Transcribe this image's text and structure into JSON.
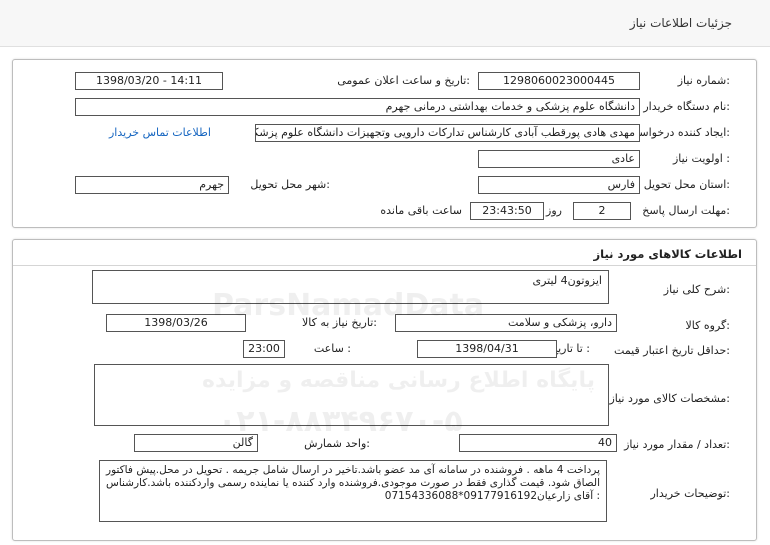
{
  "header": {
    "title": "جزئیات اطلاعات نیاز"
  },
  "need": {
    "number_label": "شماره نیاز:",
    "number": "1298060023000445",
    "announce_label": "تاریخ و ساعت اعلان عمومی:",
    "announce": "1398/03/20 - 14:11",
    "buyer_label": "نام دستگاه خریدار:",
    "buyer": "دانشگاه علوم پزشکی و خدمات بهداشتی درمانی جهرم",
    "creator_label": "ایجاد کننده درخواست:",
    "creator": "مهدی هادی پورقطب آبادی کارشناس تدارکات دارویی وتجهیزات دانشگاه علوم پزشکی جهرم",
    "contact_link": "اطلاعات تماس خریدار",
    "priority_label": "اولویت نیاز :",
    "priority": "عادی",
    "province_label": "استان محل تحویل:",
    "province": "فارس",
    "city_label": "شهر محل تحویل:",
    "city": "جهرم",
    "deadline_label": "مهلت ارسال پاسخ:",
    "days": "2",
    "days_unit": "روز و",
    "time_left": "23:43:50",
    "time_left_unit": "ساعت باقی مانده"
  },
  "goods": {
    "section_title": "اطلاعات کالاهای مورد نیاز",
    "general_label": "شرح کلی نیاز:",
    "general": "ایزوتون4 لیتری",
    "group_label": "گروه کالا:",
    "group": "دارو، پزشکی و سلامت",
    "need_date_label": "تاریخ نیاز به کالا:",
    "need_date": "1398/03/26",
    "validity_label": "حداقل تاریخ اعتبار قیمت:",
    "until_label": "تا تاریخ :",
    "until_date": "1398/04/31",
    "hour_label": "ساعت :",
    "hour": "23:00",
    "spec_label": "مشخصات کالای مورد نیاز:",
    "qty_label": "تعداد / مقدار مورد نیاز:",
    "qty": "40",
    "unit_label": "واحد شمارش:",
    "unit": "گالن",
    "notes_label": "توضیحات خریدار:",
    "notes": "پرداخت 4 ماهه . فروشنده در سامانه آی مد عضو باشد.تاخیر در ارسال شامل جریمه . تحویل در محل.پیش فاکتور الصاق شود. قیمت گذاری فقط در صورت موجودی.فروشنده وارد کننده یا نماینده رسمی واردکننده باشد.کارشناس : آقای زارعیان09177916192*07154336088"
  },
  "watermark": {
    "line1": "ParsNamadData",
    "line2": "پایگاه اطلاع رسانی مناقصه و مزایده",
    "line3": "۰۲۱-۸۸۳۴۹۶۷۰-۵"
  }
}
